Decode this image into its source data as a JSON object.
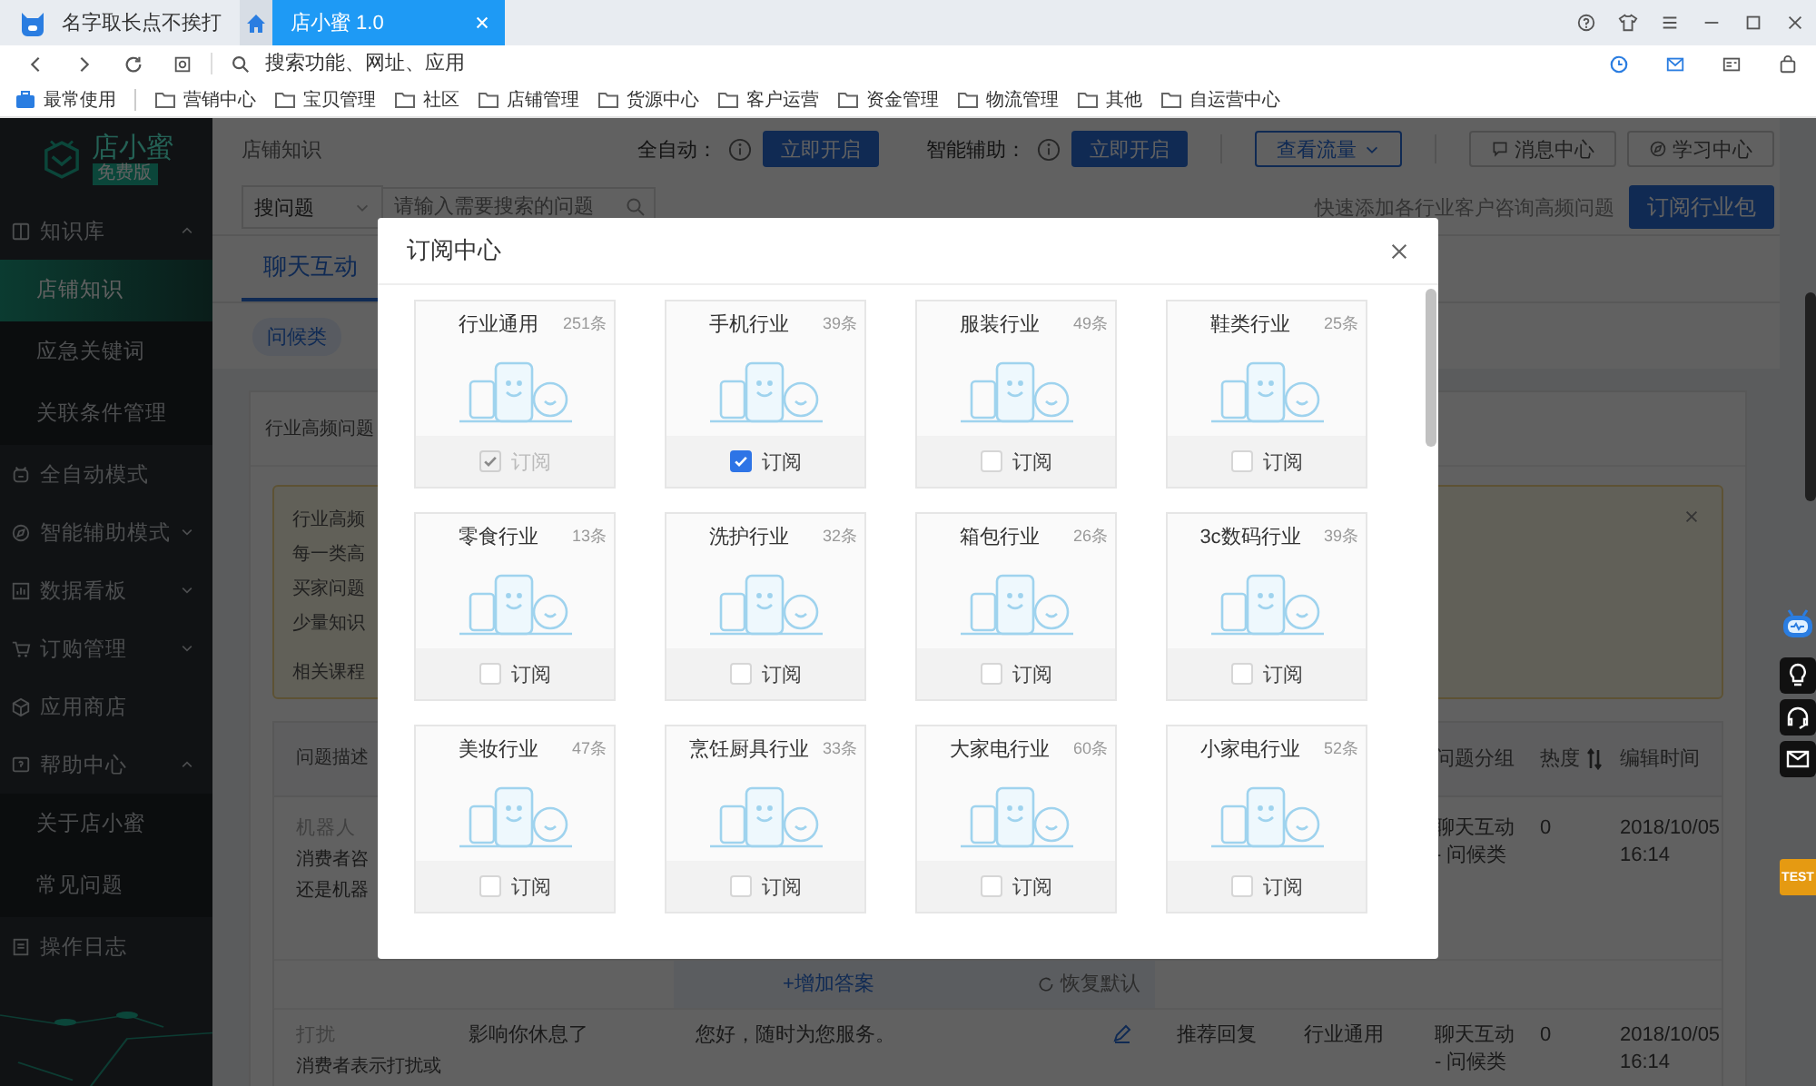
{
  "browser": {
    "profile_name": "名字取长点不挨打",
    "tabs": [
      {
        "title": "店小蜜 1.0",
        "selected": true
      }
    ],
    "address_placeholder": "搜索功能、网址、应用",
    "bookmarks": [
      {
        "label": "最常使用",
        "kind": "frequent"
      },
      {
        "label": "营销中心",
        "kind": "folder"
      },
      {
        "label": "宝贝管理",
        "kind": "folder"
      },
      {
        "label": "社区",
        "kind": "folder"
      },
      {
        "label": "店铺管理",
        "kind": "folder"
      },
      {
        "label": "货源中心",
        "kind": "folder"
      },
      {
        "label": "客户运营",
        "kind": "folder"
      },
      {
        "label": "资金管理",
        "kind": "folder"
      },
      {
        "label": "物流管理",
        "kind": "folder"
      },
      {
        "label": "其他",
        "kind": "folder"
      },
      {
        "label": "自运营中心",
        "kind": "folder"
      }
    ]
  },
  "sidebar": {
    "app_name": "店小蜜",
    "edition": "免费版",
    "items": [
      {
        "label": "知识库",
        "kind": "group",
        "expanded": true,
        "children": [
          {
            "label": "店铺知识",
            "selected": true
          },
          {
            "label": "应急关键词",
            "selected": false
          },
          {
            "label": "关联条件管理",
            "selected": false
          }
        ]
      },
      {
        "label": "全自动模式",
        "kind": "link"
      },
      {
        "label": "智能辅助模式",
        "kind": "group",
        "expanded": false
      },
      {
        "label": "数据看板",
        "kind": "group",
        "expanded": false
      },
      {
        "label": "订购管理",
        "kind": "group",
        "expanded": false
      },
      {
        "label": "应用商店",
        "kind": "link"
      },
      {
        "label": "帮助中心",
        "kind": "group",
        "expanded": true,
        "children": [
          {
            "label": "关于店小蜜",
            "selected": false
          },
          {
            "label": "常见问题",
            "selected": false
          }
        ]
      },
      {
        "label": "操作日志",
        "kind": "link"
      }
    ]
  },
  "main": {
    "breadcrumb": "店铺知识",
    "auto_label": "全自动：",
    "auto_button": "立即开启",
    "assist_label": "智能辅助：",
    "assist_button": "立即开启",
    "traffic_button": "查看流量",
    "message_button": "消息中心",
    "learn_button": "学习中心",
    "search_scope": "搜问题",
    "search_placeholder": "请输入需要搜索的问题",
    "quick_add_hint": "快速添加各行业客户咨询高频问题",
    "subscribe_button": "订阅行业包",
    "tabs": [
      {
        "label": "聊天互动",
        "selected": true
      }
    ],
    "chips": [
      {
        "label": "问候类",
        "selected": true
      }
    ],
    "section_title": "行业高频问题",
    "notice_lines": [
      "行业高频",
      "每一类高",
      "买家问题",
      "少量知识"
    ],
    "notice_link_label": "相关课程",
    "table": {
      "columns": [
        {
          "label": "问题描述"
        },
        {
          "label": "问题分组"
        },
        {
          "label": "热度",
          "sortable": true
        },
        {
          "label": "编辑时间"
        }
      ],
      "rows": [
        {
          "tag": "机器人",
          "description": "消费者咨",
          "description_2": "还是机器",
          "group": "聊天互动 - 问候类",
          "heat": "0",
          "time": "2018/10/05 16:14",
          "add_answer": "+增加答案",
          "restore": "恢复默认"
        },
        {
          "tag": "打扰",
          "description": "消费者表示打扰或",
          "question": "影响你休息了",
          "answer": "您好，随时为您服务。",
          "answer_type": "推荐回复",
          "source": "行业通用",
          "group": "聊天互动 - 问候类",
          "heat": "0",
          "time": "2018/10/05 16:14"
        }
      ]
    }
  },
  "modal": {
    "title": "订阅中心",
    "cards": [
      {
        "name": "行业通用",
        "count": "251条",
        "label": "订阅",
        "checked": true,
        "disabled": true
      },
      {
        "name": "手机行业",
        "count": "39条",
        "label": "订阅",
        "checked": true,
        "disabled": false
      },
      {
        "name": "服装行业",
        "count": "49条",
        "label": "订阅",
        "checked": false,
        "disabled": false
      },
      {
        "name": "鞋类行业",
        "count": "25条",
        "label": "订阅",
        "checked": false,
        "disabled": false
      },
      {
        "name": "零食行业",
        "count": "13条",
        "label": "订阅",
        "checked": false,
        "disabled": false
      },
      {
        "name": "洗护行业",
        "count": "32条",
        "label": "订阅",
        "checked": false,
        "disabled": false
      },
      {
        "name": "箱包行业",
        "count": "26条",
        "label": "订阅",
        "checked": false,
        "disabled": false
      },
      {
        "name": "3c数码行业",
        "count": "39条",
        "label": "订阅",
        "checked": false,
        "disabled": false
      },
      {
        "name": "美妆行业",
        "count": "47条",
        "label": "订阅",
        "checked": false,
        "disabled": false
      },
      {
        "name": "烹饪厨具行业",
        "count": "33条",
        "label": "订阅",
        "checked": false,
        "disabled": false
      },
      {
        "name": "大家电行业",
        "count": "60条",
        "label": "订阅",
        "checked": false,
        "disabled": false
      },
      {
        "name": "小家电行业",
        "count": "52条",
        "label": "订阅",
        "checked": false,
        "disabled": false
      }
    ]
  },
  "floating": {
    "test_badge": "TEST"
  }
}
